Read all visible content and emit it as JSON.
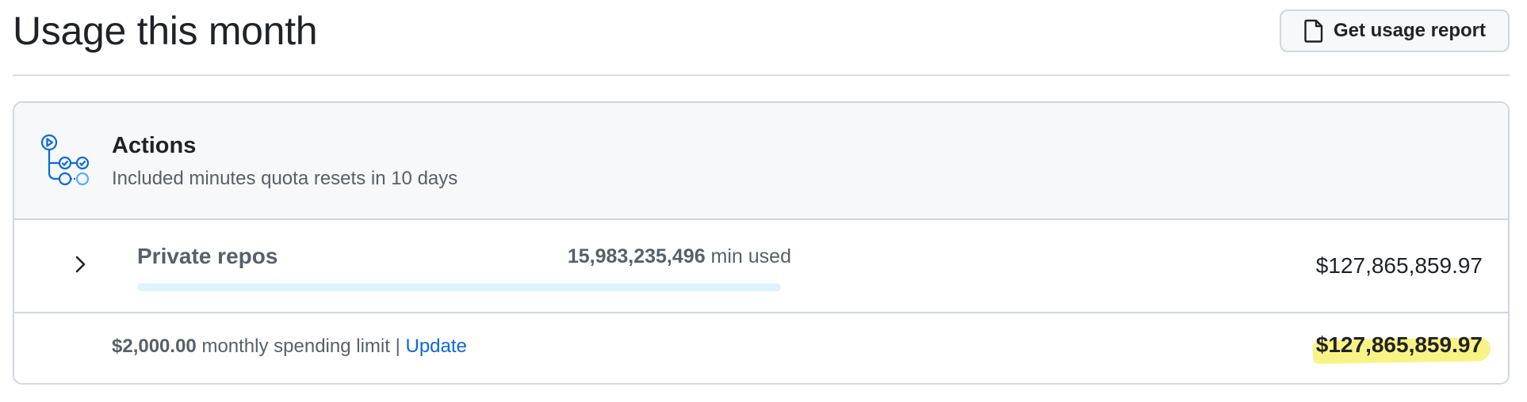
{
  "header": {
    "title": "Usage this month",
    "report_button": "Get usage report"
  },
  "actions": {
    "title": "Actions",
    "subtitle": "Included minutes quota resets in 10 days",
    "icon": "actions-workflow-icon",
    "private_repos": {
      "label": "Private repos",
      "minutes_used": "15,983,235,496",
      "minutes_suffix": "min used",
      "quota_used_fraction": 0,
      "amount": "$127,865,859.97"
    },
    "spending": {
      "limit_amount": "$2,000.00",
      "limit_text": "monthly spending limit",
      "separator": "|",
      "update_link": "Update",
      "total": "$127,865,859.97"
    }
  },
  "colors": {
    "accent": "#0969da",
    "progress_track": "#ddf4ff",
    "highlight": "#f7ef5c",
    "border": "#d0d7de",
    "header_bg": "#f6f8fa"
  }
}
